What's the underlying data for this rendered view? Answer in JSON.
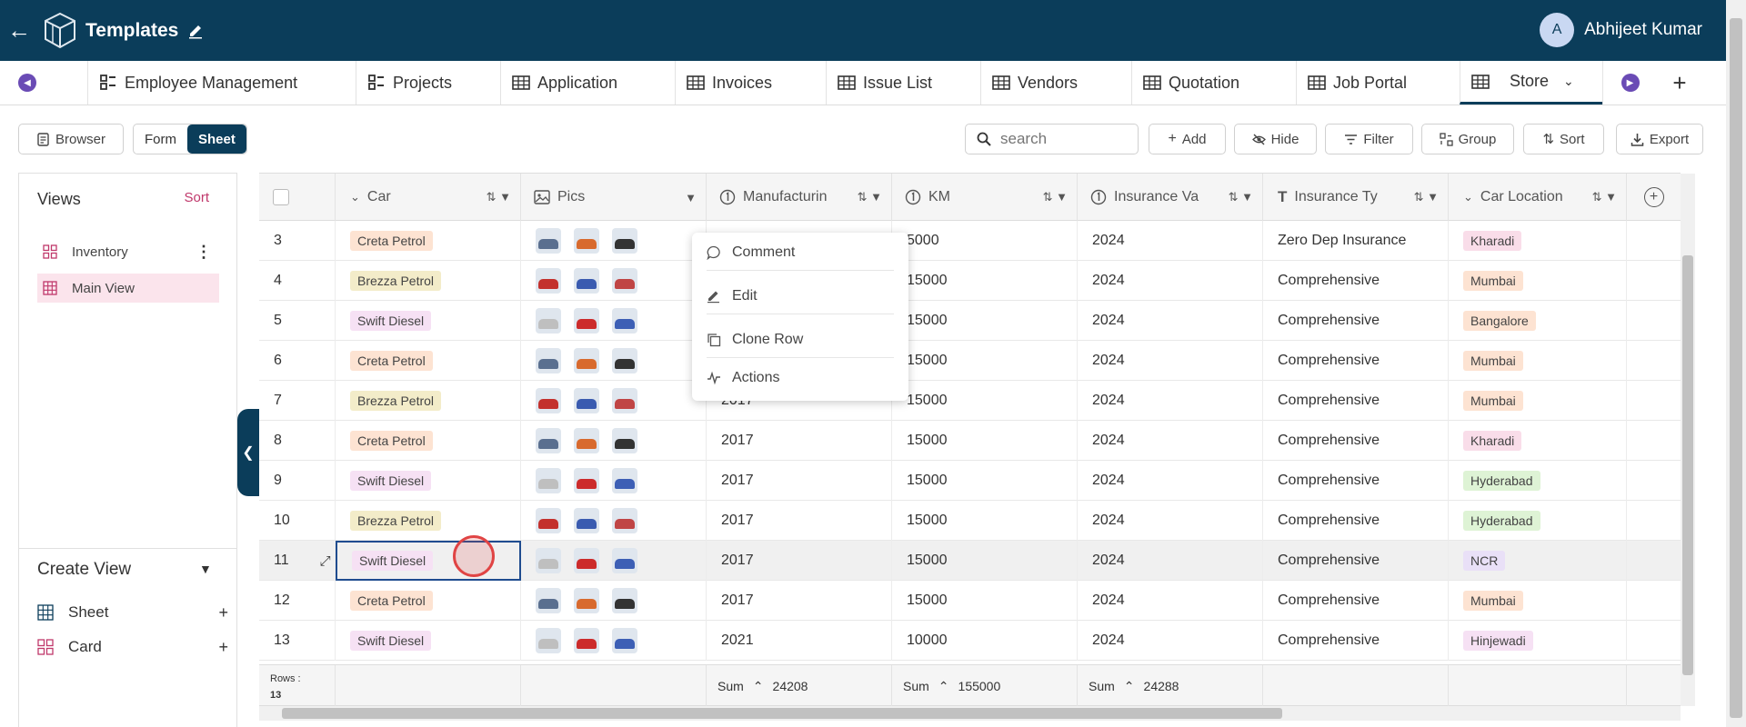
{
  "topbar": {
    "title": "Templates",
    "user_initial": "A",
    "user_name": "Abhijeet Kumar"
  },
  "tabs": [
    {
      "label": "Employee Management",
      "icon": "form-icon"
    },
    {
      "label": "Projects",
      "icon": "form-icon"
    },
    {
      "label": "Application",
      "icon": "table-icon"
    },
    {
      "label": "Invoices",
      "icon": "table-icon"
    },
    {
      "label": "Issue List",
      "icon": "table-icon"
    },
    {
      "label": "Vendors",
      "icon": "table-icon"
    },
    {
      "label": "Quotation",
      "icon": "table-icon"
    },
    {
      "label": "Job Portal",
      "icon": "table-icon"
    },
    {
      "label": "Store",
      "icon": "table-icon"
    }
  ],
  "toolbar": {
    "browser": "Browser",
    "form": "Form",
    "sheet": "Sheet",
    "search_placeholder": "search",
    "add": "Add",
    "hide": "Hide",
    "filter": "Filter",
    "group": "Group",
    "sort": "Sort",
    "export": "Export"
  },
  "sidebar": {
    "views_title": "Views",
    "views_sort": "Sort",
    "views": [
      {
        "label": "Inventory"
      },
      {
        "label": "Main View"
      }
    ],
    "create_view_title": "Create View",
    "create_items": [
      {
        "label": "Sheet"
      },
      {
        "label": "Card"
      }
    ]
  },
  "columns": {
    "car": "Car",
    "pics": "Pics",
    "manufacturing": "Manufacturin",
    "km": "KM",
    "insurance_valid": "Insurance Va",
    "insurance_type": "Insurance Ty",
    "car_location": "Car Location"
  },
  "rows": [
    {
      "no": "3",
      "car": "Creta Petrol",
      "mfg": "",
      "km": "5000",
      "ins": "2024",
      "type": "Zero Dep Insurance",
      "loc": "Kharadi"
    },
    {
      "no": "4",
      "car": "Brezza Petrol",
      "mfg": "",
      "km": "15000",
      "ins": "2024",
      "type": "Comprehensive",
      "loc": "Mumbai"
    },
    {
      "no": "5",
      "car": "Swift Diesel",
      "mfg": "",
      "km": "15000",
      "ins": "2024",
      "type": "Comprehensive",
      "loc": "Bangalore"
    },
    {
      "no": "6",
      "car": "Creta Petrol",
      "mfg": "",
      "km": "15000",
      "ins": "2024",
      "type": "Comprehensive",
      "loc": "Mumbai"
    },
    {
      "no": "7",
      "car": "Brezza Petrol",
      "mfg": "2017",
      "km": "15000",
      "ins": "2024",
      "type": "Comprehensive",
      "loc": "Mumbai"
    },
    {
      "no": "8",
      "car": "Creta Petrol",
      "mfg": "2017",
      "km": "15000",
      "ins": "2024",
      "type": "Comprehensive",
      "loc": "Kharadi"
    },
    {
      "no": "9",
      "car": "Swift Diesel",
      "mfg": "2017",
      "km": "15000",
      "ins": "2024",
      "type": "Comprehensive",
      "loc": "Hyderabad"
    },
    {
      "no": "10",
      "car": "Brezza Petrol",
      "mfg": "2017",
      "km": "15000",
      "ins": "2024",
      "type": "Comprehensive",
      "loc": "Hyderabad"
    },
    {
      "no": "11",
      "car": "Swift Diesel",
      "mfg": "2017",
      "km": "15000",
      "ins": "2024",
      "type": "Comprehensive",
      "loc": "NCR"
    },
    {
      "no": "12",
      "car": "Creta Petrol",
      "mfg": "2017",
      "km": "15000",
      "ins": "2024",
      "type": "Comprehensive",
      "loc": "Mumbai"
    },
    {
      "no": "13",
      "car": "Swift Diesel",
      "mfg": "2021",
      "km": "10000",
      "ins": "2024",
      "type": "Comprehensive",
      "loc": "Hinjewadi"
    }
  ],
  "footer": {
    "rows_label": "Rows :",
    "rows_count": "13",
    "sum_label": "Sum",
    "sum_mfg": "24208",
    "sum_km": "155000",
    "sum_ins": "24288"
  },
  "context_menu": [
    {
      "label": "Comment"
    },
    {
      "label": "Edit"
    },
    {
      "label": "Clone Row"
    },
    {
      "label": "Actions"
    }
  ],
  "colors": {
    "brand": "#0b3d5a",
    "accent_pink": "#c0386b",
    "chip_creta": "#fde3d2",
    "chip_brezza": "#f3ecc9",
    "chip_swift": "#f6e1f4",
    "loc_kharadi": "#f9dde9",
    "loc_mumbai": "#fde3d2",
    "loc_bangalore": "#fde3d2",
    "loc_hyderabad": "#def3d5",
    "loc_ncr": "#e9e0f7",
    "loc_hinjewadi": "#f6e1f4"
  }
}
